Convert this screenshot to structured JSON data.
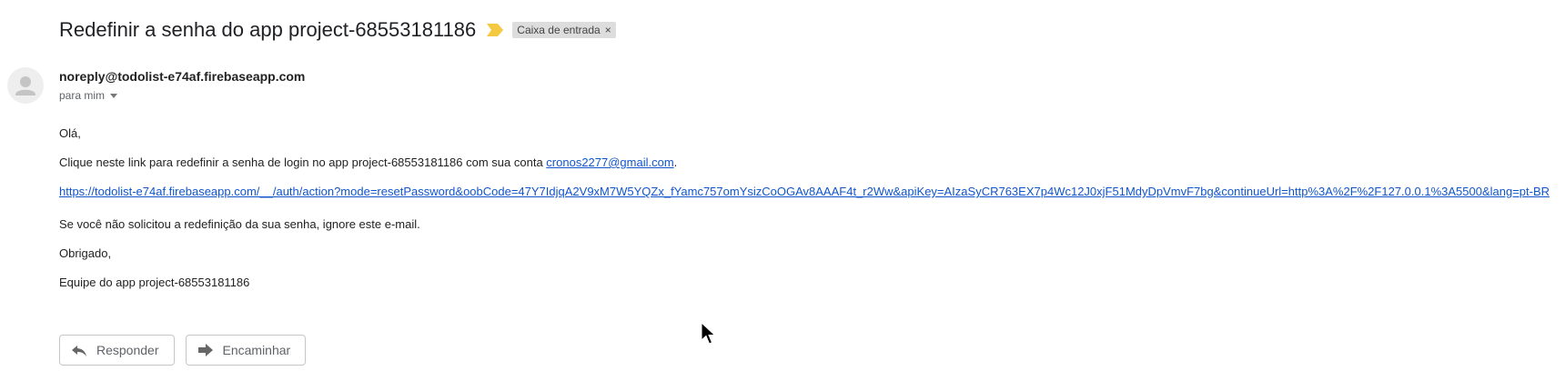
{
  "message": {
    "subject": "Redefinir a senha do app project-68553181186",
    "label": "Caixa de entrada",
    "label_remove": "×",
    "sender": "noreply@todolist-e74af.firebaseapp.com",
    "recipient": "para mim",
    "body": {
      "greeting": "Olá,",
      "line1_prefix": "Clique neste link para redefinir a senha de login no app project-68553181186 com sua conta ",
      "line1_email": "cronos2277@gmail.com",
      "line1_suffix": ".",
      "reset_link": "https://todolist-e74af.firebaseapp.com/__/auth/action?mode=resetPassword&oobCode=47Y7IdjqA2V9xM7W5YQZx_fYamc757omYsizCoOGAv8AAAF4t_r2Ww&apiKey=AIzaSyCR763EX7p4Wc12J0xjF51MdyDpVmvF7bg&continueUrl=http%3A%2F%2F127.0.0.1%3A5500&lang=pt-BR",
      "ignore_note": "Se você não solicitou a redefinição da sua senha, ignore este e-mail.",
      "thanks": "Obrigado,",
      "signature": "Equipe do app project-68553181186"
    }
  },
  "actions": {
    "reply_label": "Responder",
    "forward_label": "Encaminhar"
  },
  "icons": {
    "importance": "importance-marker-icon",
    "avatar": "default-avatar-icon",
    "reply": "reply-arrow-icon",
    "forward": "forward-arrow-icon",
    "cursor": "mouse-pointer-icon"
  },
  "colors": {
    "link": "#1155cc",
    "importance": "#f5c842",
    "label_bg": "#dddddd"
  }
}
